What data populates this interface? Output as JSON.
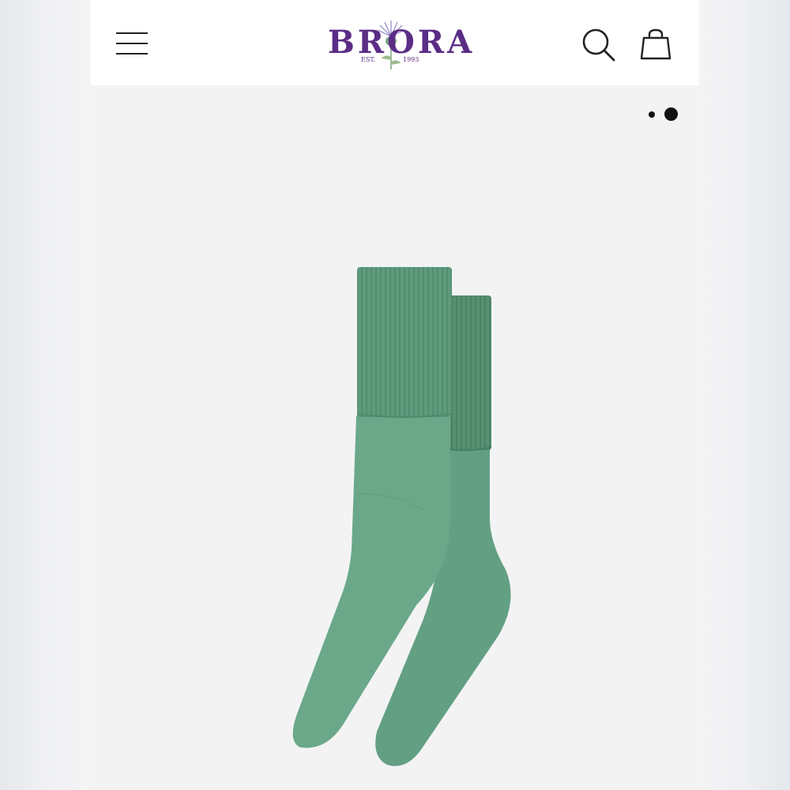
{
  "header": {
    "brand": {
      "name": "BRORA",
      "est": "EST.",
      "year": "1993",
      "color": "#5b2d86"
    },
    "icons": [
      "menu-icon",
      "search-icon",
      "shopping-bag-icon"
    ]
  },
  "gallery": {
    "slide_count": 2,
    "active_slide": 2,
    "product_color": "#5f9a7d"
  }
}
